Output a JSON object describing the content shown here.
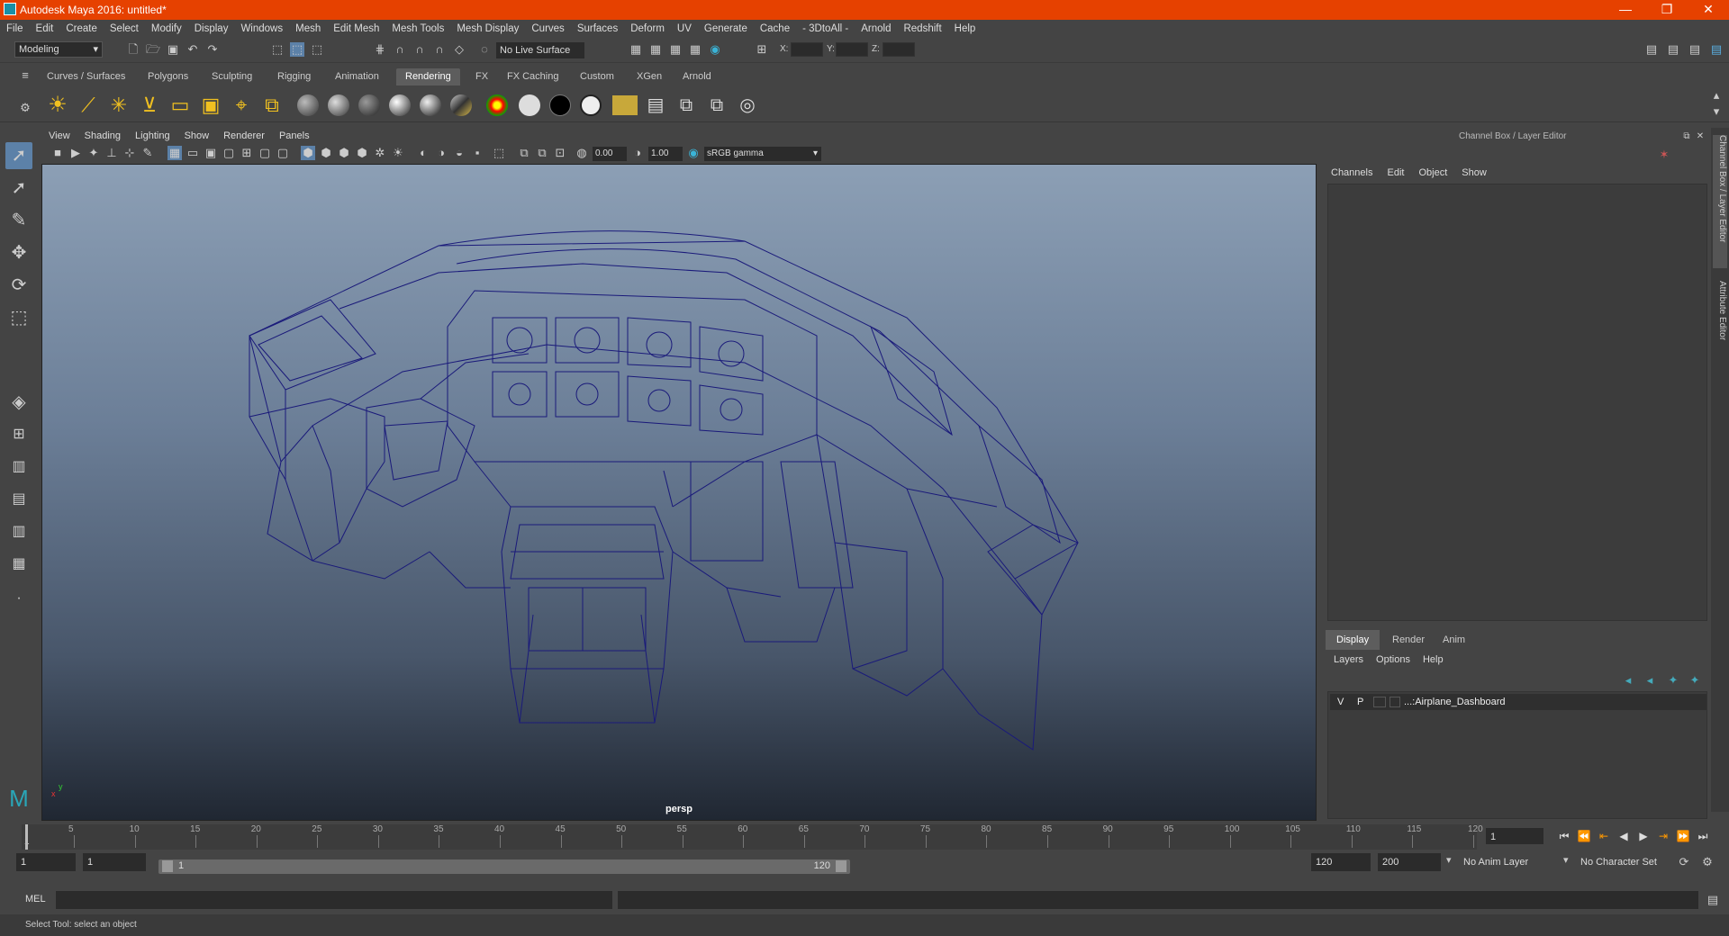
{
  "window": {
    "title": "Autodesk Maya 2016: untitled*",
    "controls": [
      "—",
      "❐",
      "✕"
    ]
  },
  "menus": [
    "File",
    "Edit",
    "Create",
    "Select",
    "Modify",
    "Display",
    "Windows",
    "Mesh",
    "Edit Mesh",
    "Mesh Tools",
    "Mesh Display",
    "Curves",
    "Surfaces",
    "Deform",
    "UV",
    "Generate",
    "Cache",
    "- 3DtoAll -",
    "Arnold",
    "Redshift",
    "Help"
  ],
  "status": {
    "mode": "Modeling",
    "live_surface": "No Live Surface",
    "x_label": "X:",
    "y_label": "Y:",
    "z_label": "Z:"
  },
  "shelf_tabs": [
    "Curves / Surfaces",
    "Polygons",
    "Sculpting",
    "Rigging",
    "Animation",
    "Rendering",
    "FX",
    "FX Caching",
    "Custom",
    "XGen",
    "Arnold"
  ],
  "active_shelf": "Rendering",
  "viewport": {
    "menus": [
      "View",
      "Shading",
      "Lighting",
      "Show",
      "Renderer",
      "Panels"
    ],
    "exposure": "0.00",
    "gamma": "1.00",
    "color_space": "sRGB gamma",
    "camera_label": "persp"
  },
  "channel_box": {
    "title": "Channel Box / Layer Editor",
    "menus": [
      "Channels",
      "Edit",
      "Object",
      "Show"
    ],
    "layer_tabs": [
      "Display",
      "Render",
      "Anim"
    ],
    "layer_menus": [
      "Layers",
      "Options",
      "Help"
    ],
    "layer": {
      "v": "V",
      "p": "P",
      "name": "...:Airplane_Dashboard"
    }
  },
  "side_tabs": [
    "Channel Box / Layer Editor",
    "Attribute Editor"
  ],
  "timeline": {
    "ticks": [
      "5",
      "10",
      "15",
      "20",
      "25",
      "30",
      "35",
      "40",
      "45",
      "50",
      "55",
      "60",
      "65",
      "70",
      "75",
      "80",
      "85",
      "90",
      "95",
      "100",
      "105",
      "110",
      "115",
      "120"
    ],
    "start_label": "1",
    "current_frame": "1"
  },
  "range": {
    "start": "1",
    "playback_start": "1",
    "slider_start": "1",
    "slider_end": "120",
    "playback_end": "120",
    "end": "200",
    "anim_layer": "No Anim Layer",
    "character_set": "No Character Set"
  },
  "command": {
    "label": "MEL"
  },
  "help_line": "Select Tool: select an object",
  "colors": {
    "title_bar": "#e64100",
    "wire": "#1a1a7a",
    "accent": "#5c81a8"
  }
}
